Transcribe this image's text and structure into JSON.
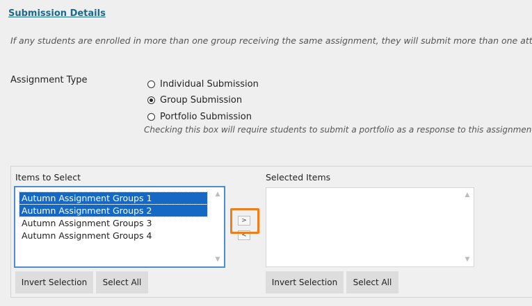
{
  "section": {
    "title": "Submission Details",
    "info": "If any students are enrolled in more than one group receiving the same assignment, they will submit more than one attempt for"
  },
  "assignment_type": {
    "label": "Assignment Type",
    "options": [
      {
        "label": "Individual Submission",
        "checked": false
      },
      {
        "label": "Group Submission",
        "checked": true
      },
      {
        "label": "Portfolio Submission",
        "checked": false
      }
    ],
    "hint": "Checking this box will require students to submit a portfolio as a response to this assignment"
  },
  "selector": {
    "left_label": "Items to Select",
    "right_label": "Selected Items",
    "items": [
      {
        "label": "Autumn Assignment Groups 1",
        "selected": true
      },
      {
        "label": "Autumn Assignment Groups 2",
        "selected": true
      },
      {
        "label": "Autumn Assignment Groups 3",
        "selected": false
      },
      {
        "label": "Autumn Assignment Groups 4",
        "selected": false
      }
    ],
    "move_right": ">",
    "move_left": "<",
    "invert_label": "Invert Selection",
    "select_all_label": "Select All"
  },
  "colors": {
    "highlight": "#f07d1a",
    "selection": "#1569c4",
    "title_link": "#1c6a8a"
  },
  "icons": {
    "move_right": "chevron-right-icon",
    "move_left": "chevron-left-icon",
    "scroll_up": "scroll-up-arrow-icon",
    "scroll_down": "scroll-down-arrow-icon"
  }
}
